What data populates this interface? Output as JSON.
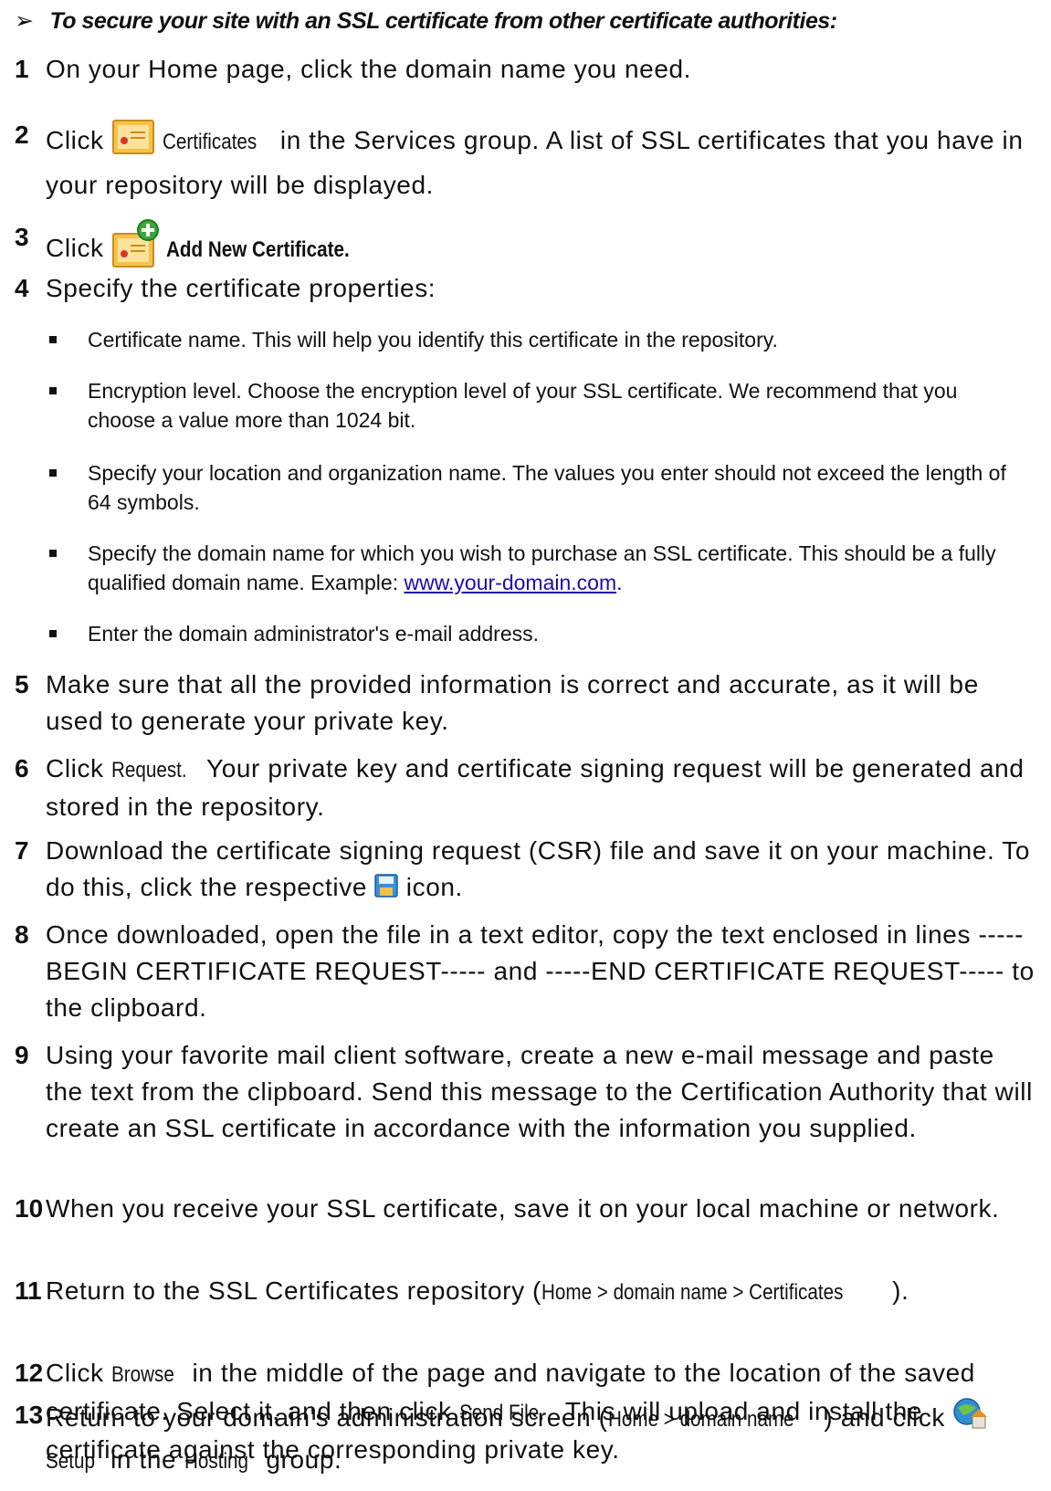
{
  "procedure": {
    "arrow": "➢",
    "title": "To secure your site with an SSL certificate from other certificate authorities:"
  },
  "steps": [
    {
      "num": "1",
      "text": "On your Home page, click the domain name you need."
    },
    {
      "num": "2",
      "pre": "Click",
      "ui": "Certificates",
      "post": "in the Services group. A list of SSL certificates that you have in your repository will be displayed."
    },
    {
      "num": "3",
      "pre": "Click",
      "ui": "Add New Certificate."
    },
    {
      "num": "4",
      "text": "Specify the certificate properties:"
    },
    {
      "num": "5",
      "text": "Make sure that all the provided information is correct and accurate, as it will be used to generate your private key."
    },
    {
      "num": "6",
      "pre": "Click",
      "ui": "Request.",
      "post": "Your private key and certificate signing request will be generated and stored in the repository."
    },
    {
      "num": "7",
      "pre": "Download the certificate signing request (CSR) file and save it on your machine. To do this, click the respective",
      "post": "icon."
    },
    {
      "num": "8",
      "text": "Once downloaded, open the file in a text editor, copy the text enclosed in lines -----BEGIN CERTIFICATE REQUEST----- and -----END CERTIFICATE REQUEST----- to the clipboard."
    },
    {
      "num": "9",
      "text": "Using your favorite mail client software, create a new e-mail message and paste the text from the clipboard. Send this message to the Certification Authority that will create an SSL certificate in accordance with the information you supplied."
    },
    {
      "num": "10",
      "text": "When you receive your SSL certificate, save it on your local machine or network."
    },
    {
      "num": "11",
      "pre": "Return to the SSL Certificates repository (",
      "ui": "Home > domain name > Certificates",
      "post": ")."
    },
    {
      "num": "12",
      "pre": "Click",
      "ui": "Browse",
      "mid": "in the middle of the page and navigate to the location of the saved certificate. Select it, and then click",
      "ui2": "Send File.",
      "post": "This will upload and install the certificate against the corresponding private key."
    },
    {
      "num": "13",
      "pre": "Return to your domain's administration screen (",
      "ui": "Home > domain name",
      "mid": ") and click",
      "ui2": "Setup",
      "mid2": "in the",
      "ui3": "Hosting",
      "post": "group."
    }
  ],
  "properties": [
    {
      "text": "Certificate name. This will help you identify this certificate in the repository."
    },
    {
      "text": "Encryption level. Choose the encryption level of your SSL certificate. We recommend that you choose a value more than 1024 bit."
    },
    {
      "text": "Specify your location and organization name. The values you enter should not exceed the length of 64 symbols."
    },
    {
      "text": "Specify the domain name for which you wish to purchase an SSL certificate. This should be a fully qualified domain name. Example:",
      "link": "www.your-domain.com",
      "after": "."
    },
    {
      "text": "Enter the domain administrator's e-mail address."
    }
  ],
  "icons": {
    "certificates": "certificate-icon",
    "add_certificate": "add-certificate-icon",
    "download": "floppy-disk-icon",
    "setup": "hosting-setup-icon"
  }
}
